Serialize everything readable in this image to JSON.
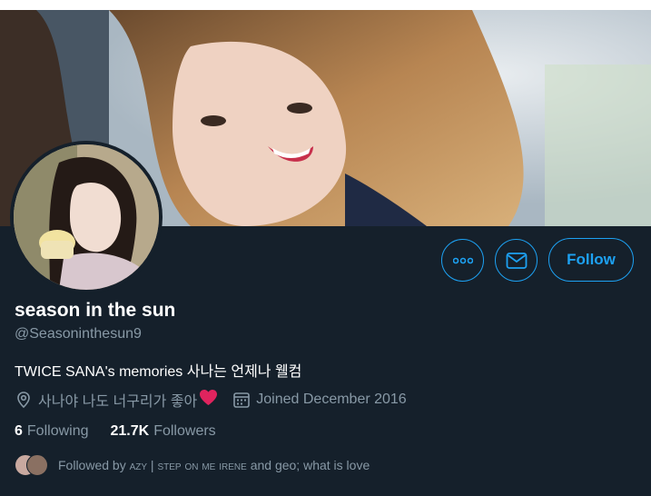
{
  "profile": {
    "name": "season in the sun",
    "handle": "@Seasoninthesun9",
    "bio": "TWICE SANA's memories 사나는 언제나 웰컴",
    "location": "사나야 나도 너구리가 좋아",
    "location_emoji": "❤️",
    "joined": "Joined December 2016"
  },
  "stats": {
    "following_count": "6",
    "following_label": "Following",
    "followers_count": "21.7K",
    "followers_label": "Followers"
  },
  "followed_by": {
    "prefix": "Followed by",
    "user1": "azy | step on me irene",
    "middle": "and",
    "user2": "geo; what is love"
  },
  "actions": {
    "follow_label": "Follow"
  },
  "icons": {
    "more": "more-icon",
    "message": "envelope-icon",
    "location": "location-pin-icon",
    "calendar": "calendar-icon"
  },
  "colors": {
    "background": "#15202b",
    "accent": "#1da1f2",
    "secondary_text": "#8899a6",
    "heart": "#e0245e"
  }
}
